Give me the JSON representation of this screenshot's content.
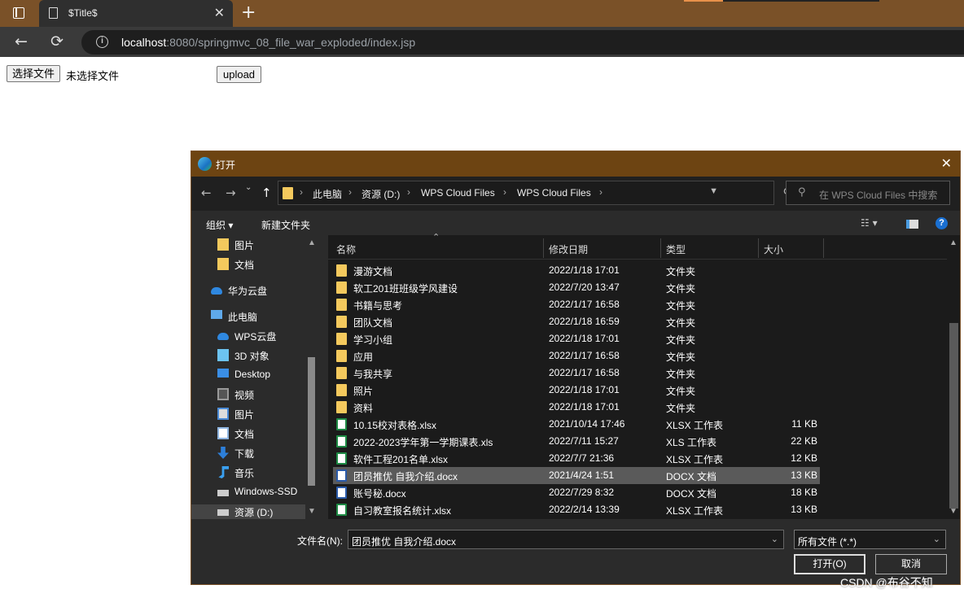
{
  "browser": {
    "tab_title": "$Title$",
    "tab_close": "✕",
    "new_tab": "+",
    "url_host": "localhost",
    "url_path": ":8080/springmvc_08_file_war_exploded/index.jsp",
    "back": "←",
    "reload": "⟳"
  },
  "page": {
    "choose_file_label": "选择文件",
    "no_file_label": "未选择文件",
    "upload_label": "upload"
  },
  "dialog": {
    "title": "打开",
    "close": "✕",
    "breadcrumbs": [
      "此电脑",
      "资源 (D:)",
      "WPS Cloud Files",
      "WPS Cloud Files"
    ],
    "search_placeholder": "在 WPS Cloud Files 中搜索",
    "toolbar": {
      "organize": "组织 ▾",
      "new_folder": "新建文件夹"
    },
    "columns": {
      "name": "名称",
      "date": "修改日期",
      "type": "类型",
      "size": "大小"
    },
    "sidebar": [
      {
        "label": "图片",
        "icon": "folder-icon"
      },
      {
        "label": "文档",
        "icon": "folder-icon"
      },
      {
        "label": "华为云盘",
        "icon": "cloud-icon"
      },
      {
        "label": "此电脑",
        "icon": "computer-icon"
      },
      {
        "label": "WPS云盘",
        "icon": "cloud-icon"
      },
      {
        "label": "3D 对象",
        "icon": "cube-icon"
      },
      {
        "label": "Desktop",
        "icon": "desktop-icon"
      },
      {
        "label": "视频",
        "icon": "video-icon"
      },
      {
        "label": "图片",
        "icon": "picture-icon"
      },
      {
        "label": "文档",
        "icon": "document-icon"
      },
      {
        "label": "下载",
        "icon": "download-icon"
      },
      {
        "label": "音乐",
        "icon": "music-icon"
      },
      {
        "label": "Windows-SSD",
        "icon": "drive-icon"
      },
      {
        "label": "资源 (D:)",
        "icon": "drive-icon"
      }
    ],
    "files": [
      {
        "name": "漫游文档",
        "date": "2022/1/18 17:01",
        "type": "文件夹",
        "size": "",
        "kind": "folder"
      },
      {
        "name": "软工201班班级学风建设",
        "date": "2022/7/20 13:47",
        "type": "文件夹",
        "size": "",
        "kind": "folder"
      },
      {
        "name": "书籍与思考",
        "date": "2022/1/17 16:58",
        "type": "文件夹",
        "size": "",
        "kind": "folder"
      },
      {
        "name": "团队文档",
        "date": "2022/1/18 16:59",
        "type": "文件夹",
        "size": "",
        "kind": "folder"
      },
      {
        "name": "学习小组",
        "date": "2022/1/18 17:01",
        "type": "文件夹",
        "size": "",
        "kind": "folder"
      },
      {
        "name": "应用",
        "date": "2022/1/17 16:58",
        "type": "文件夹",
        "size": "",
        "kind": "folder"
      },
      {
        "name": "与我共享",
        "date": "2022/1/17 16:58",
        "type": "文件夹",
        "size": "",
        "kind": "folder"
      },
      {
        "name": "照片",
        "date": "2022/1/18 17:01",
        "type": "文件夹",
        "size": "",
        "kind": "folder"
      },
      {
        "name": "资料",
        "date": "2022/1/18 17:01",
        "type": "文件夹",
        "size": "",
        "kind": "folder"
      },
      {
        "name": "10.15校对表格.xlsx",
        "date": "2021/10/14 17:46",
        "type": "XLSX 工作表",
        "size": "11 KB",
        "kind": "xlsx"
      },
      {
        "name": "2022-2023学年第一学期课表.xls",
        "date": "2022/7/11 15:27",
        "type": "XLS 工作表",
        "size": "22 KB",
        "kind": "xlsx"
      },
      {
        "name": "软件工程201名单.xlsx",
        "date": "2022/7/7 21:36",
        "type": "XLSX 工作表",
        "size": "12 KB",
        "kind": "xlsx"
      },
      {
        "name": "团员推优 自我介绍.docx",
        "date": "2021/4/24 1:51",
        "type": "DOCX 文档",
        "size": "13 KB",
        "kind": "docx",
        "selected": true
      },
      {
        "name": "账号秘.docx",
        "date": "2022/7/29 8:32",
        "type": "DOCX 文档",
        "size": "18 KB",
        "kind": "docx"
      },
      {
        "name": "自习教室报名统计.xlsx",
        "date": "2022/2/14 13:39",
        "type": "XLSX 工作表",
        "size": "13 KB",
        "kind": "xlsx"
      }
    ],
    "filename_label": "文件名(N):",
    "filename_value": "团员推优 自我介绍.docx",
    "filetype_value": "所有文件 (*.*)",
    "open_label": "打开(O)",
    "cancel_label": "取消"
  },
  "watermark": "CSDN @布谷不知"
}
